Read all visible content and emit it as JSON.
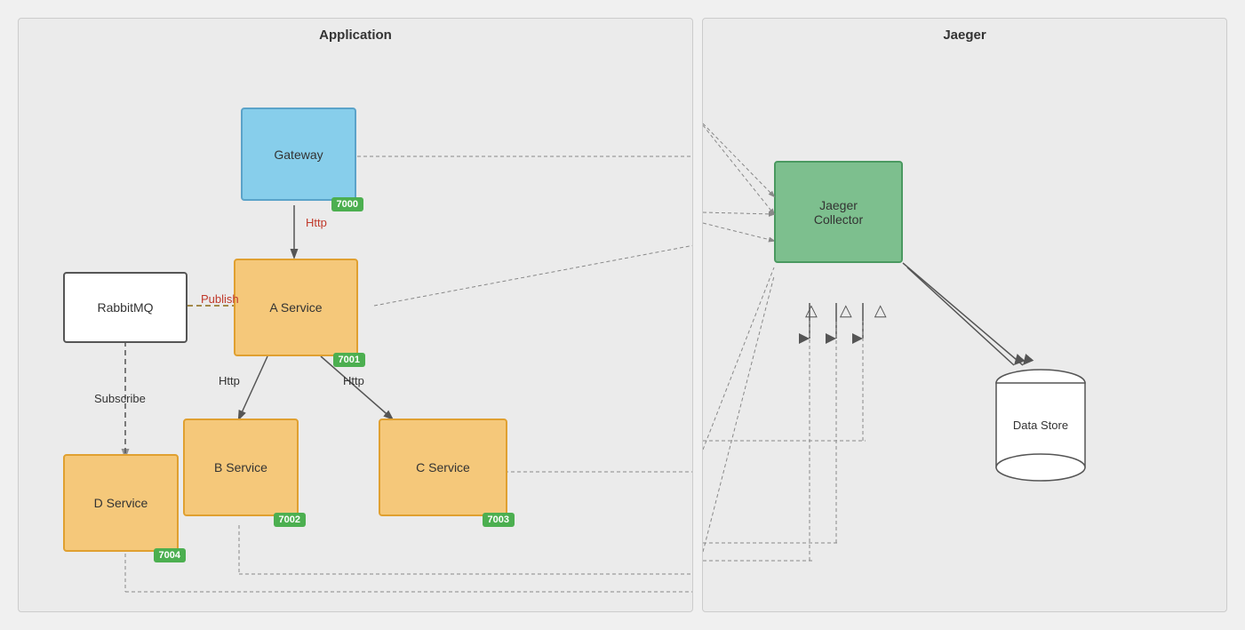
{
  "panels": {
    "left": {
      "title": "Application"
    },
    "right": {
      "title": "Jaeger"
    }
  },
  "nodes": {
    "gateway": {
      "label": "Gateway",
      "port": "7000"
    },
    "aService": {
      "label": "A Service",
      "port": "7001"
    },
    "bService": {
      "label": "B Service",
      "port": "7002"
    },
    "cService": {
      "label": "C Service",
      "port": "7003"
    },
    "dService": {
      "label": "D Service",
      "port": "7004"
    },
    "rabbitMQ": {
      "label": "RabbitMQ"
    },
    "jaegerCollector": {
      "label1": "Jaeger",
      "label2": "Collector"
    },
    "dataStore": {
      "label": "Data Store"
    }
  },
  "edges": {
    "http1": "Http",
    "http2": "Http",
    "http3": "Http",
    "publish": "Publish",
    "subscribe": "Subscribe"
  }
}
